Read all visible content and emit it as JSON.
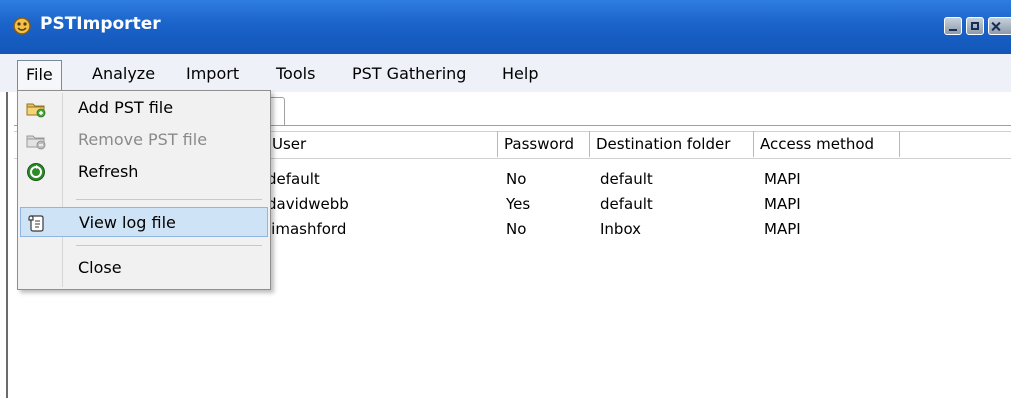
{
  "window": {
    "title": "PSTImporter",
    "titlebar_color": "#1a63c9"
  },
  "menubar": {
    "items": [
      {
        "label": "File",
        "open": true
      },
      {
        "label": "Analyze"
      },
      {
        "label": "Import"
      },
      {
        "label": "Tools"
      },
      {
        "label": "PST Gathering"
      },
      {
        "label": "Help"
      }
    ]
  },
  "file_menu": {
    "items": [
      {
        "label": "Add PST file",
        "icon": "folder-add-icon",
        "enabled": true
      },
      {
        "label": "Remove PST file",
        "icon": "folder-remove-icon",
        "enabled": false
      },
      {
        "label": "Refresh",
        "icon": "refresh-icon",
        "enabled": true
      },
      {
        "label": "View log file",
        "icon": "log-scroll-icon",
        "enabled": true,
        "highlighted": true
      },
      {
        "label": "Close",
        "enabled": true
      }
    ]
  },
  "table": {
    "columns": [
      "User",
      "Password",
      "Destination folder",
      "Access method"
    ],
    "rows": [
      {
        "user": "default",
        "password": "No",
        "folder": "default",
        "access": "MAPI"
      },
      {
        "user": "davidwebb",
        "password": "Yes",
        "folder": "default",
        "access": "MAPI"
      },
      {
        "user": "jimashford",
        "password": "No",
        "folder": "Inbox",
        "access": "MAPI"
      }
    ]
  }
}
